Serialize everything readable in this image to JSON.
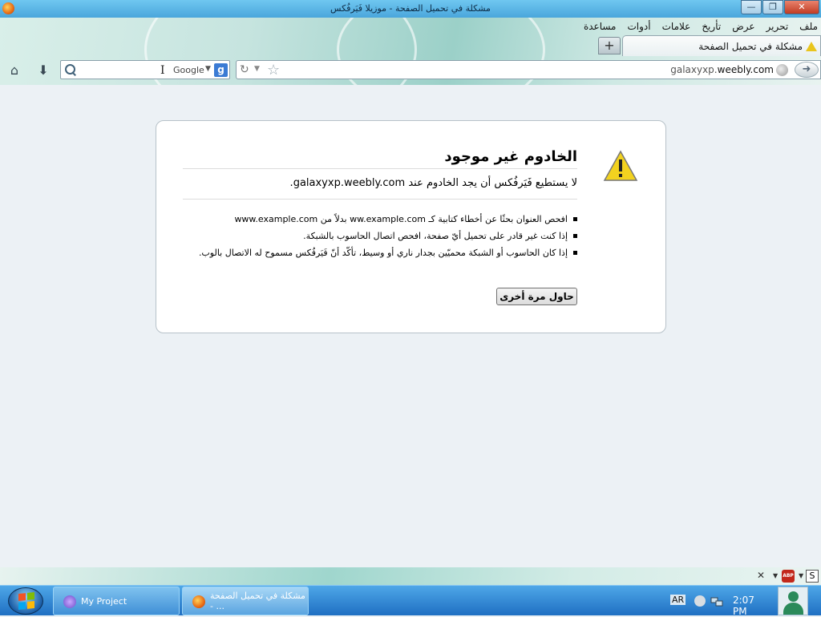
{
  "window": {
    "title": "مشكلة في تحميل الصفحة - موزيلا فَيَرفُكس",
    "buttons": {
      "minimize": "—",
      "restore": "❐",
      "close": "✕"
    }
  },
  "menubar": [
    "ملف",
    "تحرير",
    "عرض",
    "تأريخ",
    "علامات",
    "أدوات",
    "مساعدة"
  ],
  "tab": {
    "label": "مشكلة في تحميل الصفحة",
    "new_tab": "+"
  },
  "search": {
    "engine": "Google",
    "engine_icon": "g"
  },
  "urlbar": {
    "url_prefix": "galaxyxp.",
    "url_main": "weebly.com"
  },
  "error": {
    "title": "الخادوم غير موجود",
    "description": "لا يستطيع فَيَرفُكس أن يجد الخادوم عند galaxyxp.weebly.com.",
    "items": [
      "افحص العنوان بحثًا عن أخطاء كتابية كـ ww.example.com بدلاً من www.example.com",
      "إذا كنت غير قادر على تحميل أيّ صفحة، افحص اتصال الحاسوب بالشبكة.",
      "إذا كان الحاسوب أو الشبكة محميّين بجدار ناري أو وسيط، تأكّد أنّ فَيَرفُكس مسموح له الاتصال بالوب."
    ],
    "retry_label": "حاول مرة أخرى"
  },
  "addonbar": {
    "close": "✕",
    "abp": "ABP",
    "s_button": "S"
  },
  "taskbar": {
    "items": [
      {
        "label": "My Project"
      },
      {
        "label": "مشكلة في تحميل الصفحة - ..."
      }
    ],
    "language": "AR",
    "clock": "2:07 PM"
  }
}
